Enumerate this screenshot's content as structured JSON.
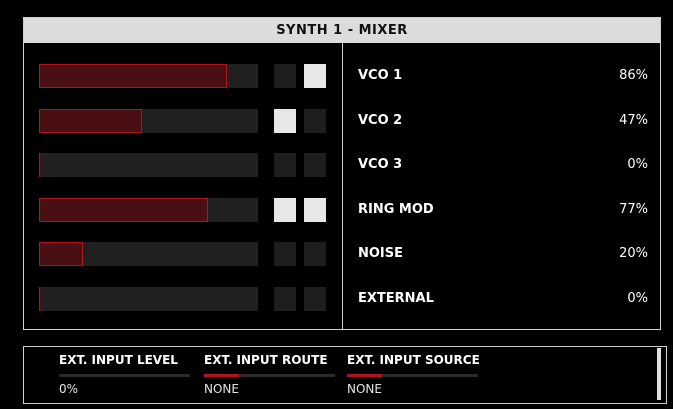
{
  "header": {
    "title": "SYNTH 1 - MIXER"
  },
  "channels": [
    {
      "name": "VCO 1",
      "value": "86%",
      "level": 0.86,
      "toggle_a": false,
      "toggle_b": true
    },
    {
      "name": "VCO 2",
      "value": "47%",
      "level": 0.47,
      "toggle_a": true,
      "toggle_b": false
    },
    {
      "name": "VCO 3",
      "value": "0%",
      "level": 0.0,
      "toggle_a": false,
      "toggle_b": false
    },
    {
      "name": "RING MOD",
      "value": "77%",
      "level": 0.77,
      "toggle_a": true,
      "toggle_b": true
    },
    {
      "name": "NOISE",
      "value": "20%",
      "level": 0.2,
      "toggle_a": false,
      "toggle_b": false
    },
    {
      "name": "EXTERNAL",
      "value": "0%",
      "level": 0.0,
      "toggle_a": false,
      "toggle_b": false
    }
  ],
  "bottom": {
    "params": [
      {
        "title": "EXT. INPUT LEVEL",
        "value": "0%",
        "level": 0.0
      },
      {
        "title": "EXT. INPUT ROUTE",
        "value": "NONE",
        "level": 0.27
      },
      {
        "title": "EXT. INPUT SOURCE",
        "value": "NONE",
        "level": 0.27
      }
    ]
  },
  "colors": {
    "accent": "#b0141c",
    "fill": "#4a0f12",
    "toggle_on": "#e8e8e8",
    "toggle_off": "#1e1e1e"
  }
}
